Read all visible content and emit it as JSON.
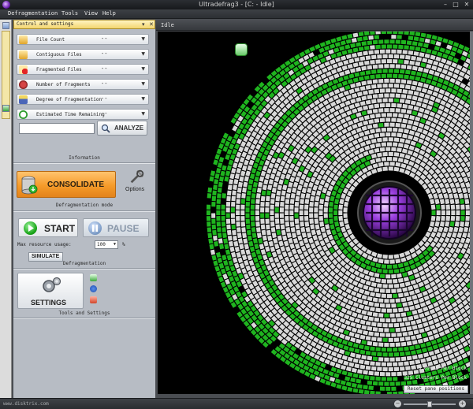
{
  "window": {
    "title": "Ultradefrag3 - [C: - Idle]",
    "controls": [
      "–",
      "□",
      "✕"
    ]
  },
  "menu": {
    "items": [
      "Defragmentation",
      "Tools",
      "View",
      "Help"
    ]
  },
  "panel": {
    "header": "Control and settings",
    "stats": [
      {
        "label": "File Count",
        "value": "--"
      },
      {
        "label": "Contiguous Files",
        "value": "--"
      },
      {
        "label": "Fragmented Files",
        "value": "--"
      },
      {
        "label": "Number of Fragments",
        "value": "--"
      },
      {
        "label": "Degree of Fragmentation",
        "value": "--"
      },
      {
        "label": "Estimated Time Remaining",
        "value": "--"
      }
    ],
    "analyze_label": "ANALYZE",
    "drive_value": "",
    "information_caption": "Information",
    "consolidate_label": "CONSOLIDATE",
    "options_label": "Options",
    "mode_caption": "Defragmentation mode",
    "start_label": "START",
    "pause_label": "PAUSE",
    "resource_label": "Max resource usage:",
    "resource_value": "100",
    "resource_unit": "%",
    "simulate_label": "SIMULATE",
    "defrag_caption": "Defragmentation",
    "settings_label": "SETTINGS",
    "tools_caption": "Tools and Settings"
  },
  "map": {
    "header": "Idle",
    "mb_per_block": "5.09 MB Per Block",
    "clusters_per_block": "325 Clusters Per Block",
    "reset_label": "Reset pane positions",
    "colors": {
      "used": "#d9d9d9",
      "fragmented": "#1fb51f",
      "free": "#000000",
      "accent": "#9b3fe0"
    }
  },
  "status": {
    "url": "www.disktrix.com",
    "zoom_level": 0.5
  }
}
